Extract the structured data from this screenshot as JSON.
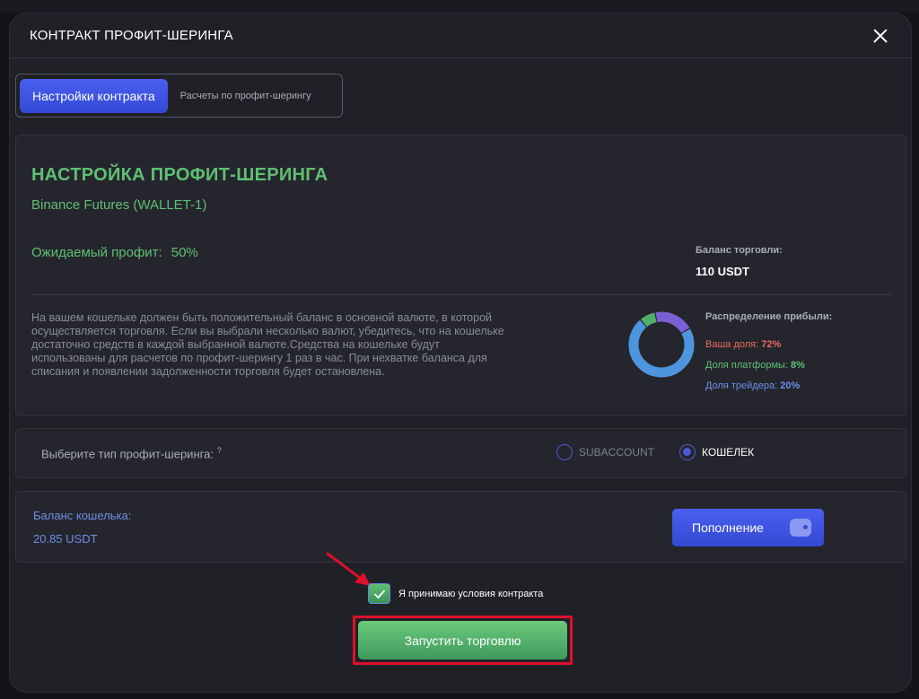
{
  "modal": {
    "title": "КОНТРАКТ ПРОФИТ-ШЕРИНГА"
  },
  "tabs": [
    {
      "label": "Настройки контракта",
      "active": true
    },
    {
      "label": "Расчеты по профит-шерингу",
      "active": false
    }
  ],
  "settings": {
    "title": "НАСТРОЙКА ПРОФИТ-ШЕРИНГА",
    "exchange": "Binance Futures (WALLET-1)",
    "expected_profit_label": "Ожидаемый профит:",
    "expected_profit_value": "50%",
    "trading_balance_label": "Баланс торговли:",
    "trading_balance_value": "110 USDT",
    "notice": "На вашем кошельке должен быть положительный баланс в основной валюте, в которой осуществляется торговля. Если вы выбрали несколько валют, убедитесь, что на кошельке достаточно средств в каждой выбранной валюте.Средства на кошельке будут использованы для расчетов по профит-шерингу 1 раз в час. При нехватке баланса для списания и появлении задолженности торговля будет остановлена.",
    "distribution": {
      "title": "Распределение прибыли:",
      "items": [
        {
          "label": "Ваша доля:",
          "value": "72%",
          "share": 72,
          "color": "#4d96de"
        },
        {
          "label": "Доля платформы:",
          "value": "8%",
          "share": 8,
          "color": "#4fae6a"
        },
        {
          "label": "Доля трейдера:",
          "value": "20%",
          "share": 20,
          "color": "#7b5fd6"
        }
      ]
    }
  },
  "profit_type": {
    "label": "Выберите тип профит-шеринга:",
    "hint": "?",
    "options": [
      {
        "label": "SUBACCOUNT",
        "selected": false
      },
      {
        "label": "КОШЕЛЕК",
        "selected": true
      }
    ]
  },
  "wallet": {
    "balance_label": "Баланс кошелька:",
    "balance_value": "20.85 USDT",
    "topup_label": "Пополнение"
  },
  "agreement": {
    "label": "Я принимаю условия контракта",
    "checked": true
  },
  "start_button": {
    "label": "Запустить торговлю"
  },
  "colors": {
    "accent_blue": "#3f54e0",
    "green": "#5fbf73",
    "highlight_red": "#e0102a"
  }
}
